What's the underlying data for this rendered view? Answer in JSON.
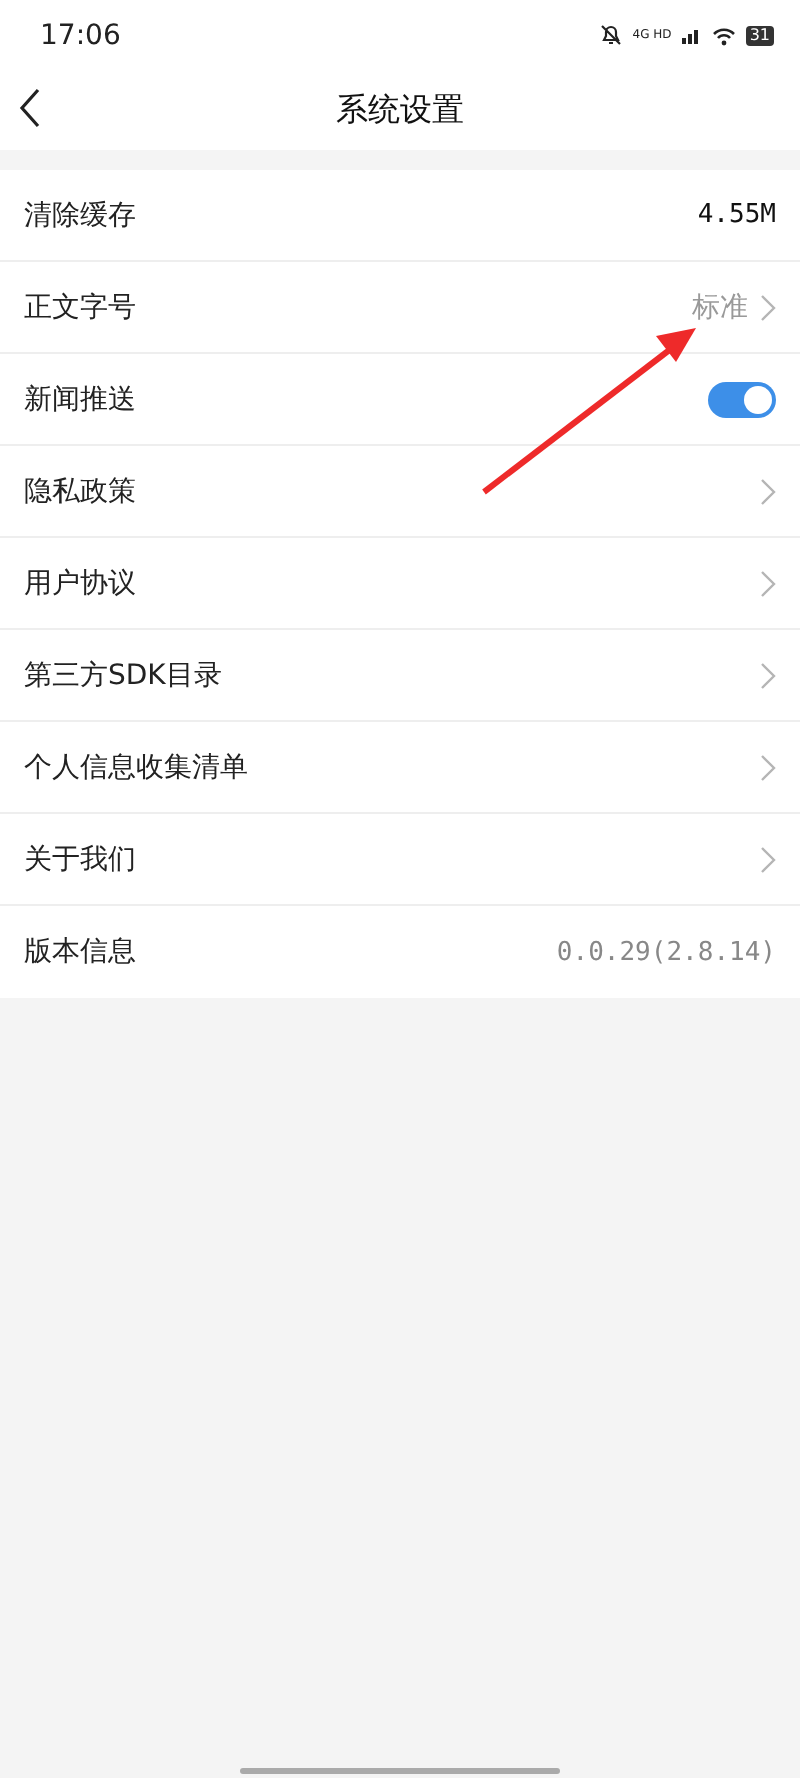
{
  "status_bar": {
    "time": "17:06",
    "network": "4G HD",
    "battery": "31"
  },
  "nav": {
    "title": "系统设置"
  },
  "rows": [
    {
      "kind": "value",
      "label": "清除缓存",
      "value": "4.55M"
    },
    {
      "kind": "select",
      "label": "正文字号",
      "value": "标准"
    },
    {
      "kind": "toggle",
      "label": "新闻推送",
      "on": true
    },
    {
      "kind": "link",
      "label": "隐私政策"
    },
    {
      "kind": "link",
      "label": "用户协议"
    },
    {
      "kind": "link",
      "label": "第三方SDK目录"
    },
    {
      "kind": "link",
      "label": "个人信息收集清单"
    },
    {
      "kind": "link",
      "label": "关于我们"
    },
    {
      "kind": "info",
      "label": "版本信息",
      "value": "0.0.29(2.8.14)"
    }
  ]
}
